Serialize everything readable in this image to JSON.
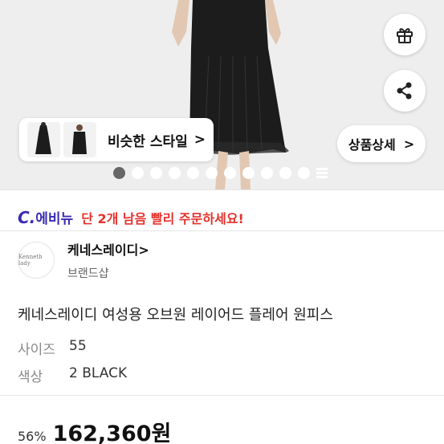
{
  "hero": {
    "similar_style_label": "비슷한 스타일",
    "similar_style_chevron": ">",
    "detail_label": "상품상세",
    "detail_chevron": ">",
    "dots_total": 11,
    "dots_active_index": 0
  },
  "promo": {
    "logo_prefix": "C.",
    "logo_text": "에비뉴",
    "message": "단 2개 남음 빨리 주문하세요!",
    "logo_color": "#3a2bb5",
    "message_color": "#e5322d"
  },
  "brand": {
    "logo_text": "Kenneth lady",
    "name": "케네스레이디",
    "name_chevron": ">",
    "shop_label": "브랜드샵"
  },
  "product": {
    "title": "케네스레이디 여성용 오브원 레이어드 플레어 원피스",
    "options": [
      {
        "key": "사이즈",
        "value": "55"
      },
      {
        "key": "색상",
        "value": "2 BLACK"
      }
    ],
    "discount": "56%",
    "price": "162,360원"
  }
}
